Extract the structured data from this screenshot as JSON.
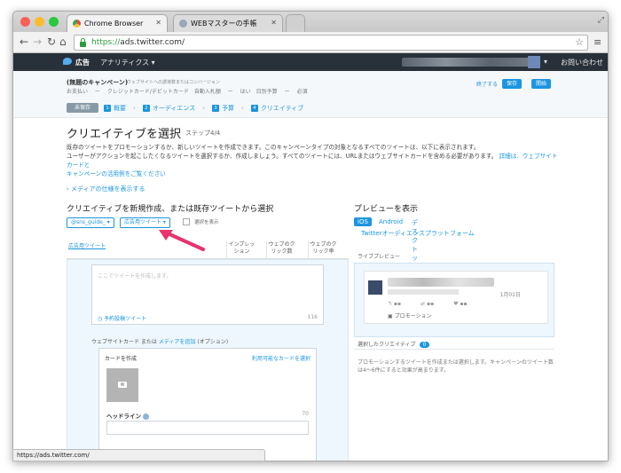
{
  "browser": {
    "tabs": [
      {
        "label": "Chrome Browser",
        "active": true
      },
      {
        "label": "WEBマスターの手帳",
        "active": false
      }
    ],
    "url_scheme": "https://",
    "url_rest": "ads.twitter.com/",
    "status_url": "https://ads.twitter.com/"
  },
  "twitter_nav": {
    "brand": "広告",
    "analytics": "アナリティクス ▾",
    "contact": "お問い合わせ"
  },
  "campaign": {
    "name": "(無題のキャンペーン)",
    "subtitle": "ウェブサイトへの誘導数またはコンバージョン",
    "meta": "お支払い ー クレジットカード/デビットカード　自動入札額 ー はい　日別予算 ー 必須",
    "end_label": "終了する",
    "save_label": "保存",
    "start_label": "開始",
    "draft_label": "未保存",
    "steps": [
      {
        "num": "1",
        "label": "概要"
      },
      {
        "num": "2",
        "label": "オーディエンス"
      },
      {
        "num": "3",
        "label": "予算"
      },
      {
        "num": "4",
        "label": "クリエイティブ"
      }
    ]
  },
  "main": {
    "title": "クリエイティブを選択",
    "step_info": "ステップ4/4",
    "desc1": "既存のツイートをプロモーションするか、新しいツイートを作成できます。このキャンペーンタイプの対象となるすべてのツイートは、以下に表示されます。",
    "desc2": "ユーザーがアクションを起こしたくなるツイートを選択するか、作成しましょう。すべてのツイートには、URLまたはウェブサイトカードを含める必要があります。",
    "desc_link1": "詳細は、ウェブサイトカードと",
    "desc_link2": "キャンペーンの活用例をご覧ください",
    "media_spec": "メディアの仕様を表示する",
    "left_heading": "クリエイティブを新規作成、または既存ツイートから選択",
    "account_pill": "@sns_guide_ ▾",
    "type_pill": "広告用ツイート ▾",
    "checkbox_label": "選択を表示",
    "table_headers": {
      "ad_tweet": "広告用ツイート",
      "impressions": "インプレッション",
      "web_clicks": "ウェブのクリック数",
      "web_click_rate": "ウェブのクリック率"
    },
    "composer": {
      "placeholder": "ここでツイートを作成します。",
      "schedule": "予約投稿ツイート",
      "char_count": "116"
    },
    "webcard_label_a": "ウェブサイトカード または",
    "webcard_label_b": "メディアを追加",
    "webcard_label_c": "(オプション)",
    "webcard": {
      "title": "カードを作成",
      "available": "利用可能なカードを選択",
      "headline": "ヘッドライン",
      "headline_max": "70"
    }
  },
  "preview": {
    "heading": "プレビューを表示",
    "tabs": [
      "iOS",
      "Android",
      "デスクトップ",
      "Twitterオーディエンスプラットフォーム"
    ],
    "live_label": "ライブプレビュー",
    "tweet_time": "1月01日",
    "promo": "プロモーション",
    "selected_label": "選択したクリエイティブ",
    "selected_count": "0",
    "selected_desc": "プロモーションするツイートを作成または選択します。キャンペーンのツイート数は4〜6件にすると効果が高まります。"
  },
  "colors": {
    "accent": "#1b95e0",
    "navbar": "#28303a",
    "arrow": "#e8336d"
  }
}
